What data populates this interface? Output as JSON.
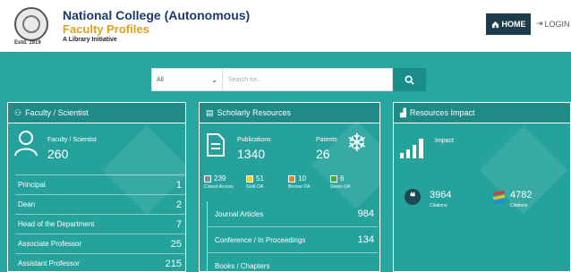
{
  "header": {
    "title": "National College (Autonomous)",
    "subtitle": "Faculty Profiles",
    "tagline": "A Library Initiative",
    "estd": "Estd. 1919"
  },
  "nav": {
    "home": "HOME",
    "login": "LOGIN"
  },
  "search": {
    "select_value": "All",
    "placeholder": "Search for..."
  },
  "faculty": {
    "title": "Faculty / Scientist",
    "label": "Faculty / Scientist",
    "count": "260",
    "rows": [
      {
        "label": "Principal",
        "value": "1"
      },
      {
        "label": "Dean",
        "value": "2"
      },
      {
        "label": "Head of the Department",
        "value": "7"
      },
      {
        "label": "Associate Professor",
        "value": "25"
      },
      {
        "label": "Assistant Professor",
        "value": "215"
      }
    ]
  },
  "scholarly": {
    "title": "Scholarly Resources",
    "pub_label": "Publications",
    "pub_count": "1340",
    "pat_label": "Patents",
    "pat_count": "26",
    "oa": [
      {
        "value": "239",
        "label": "Closed Access",
        "color": "#8a8a8a"
      },
      {
        "value": "51",
        "label": "Gold OA",
        "color": "#f2d21b"
      },
      {
        "value": "10",
        "label": "Bronze OA",
        "color": "#d8892e"
      },
      {
        "value": "6",
        "label": "Green OA",
        "color": "#4caa3a"
      }
    ],
    "rows": [
      {
        "label": "Journal Articles",
        "value": "984"
      },
      {
        "label": "Conference / In Proceedings",
        "value": "134"
      },
      {
        "label": "Books / Chapters",
        "value": ""
      }
    ]
  },
  "impact": {
    "title": "Resources Impact",
    "label": "Impact",
    "c1_value": "3964",
    "c1_label": "Citations",
    "c2_value": "4782",
    "c2_label": "Citations"
  },
  "colors": {
    "teal": "#2aa6a0",
    "navy": "#1c3a6b",
    "gold": "#e0a020"
  }
}
